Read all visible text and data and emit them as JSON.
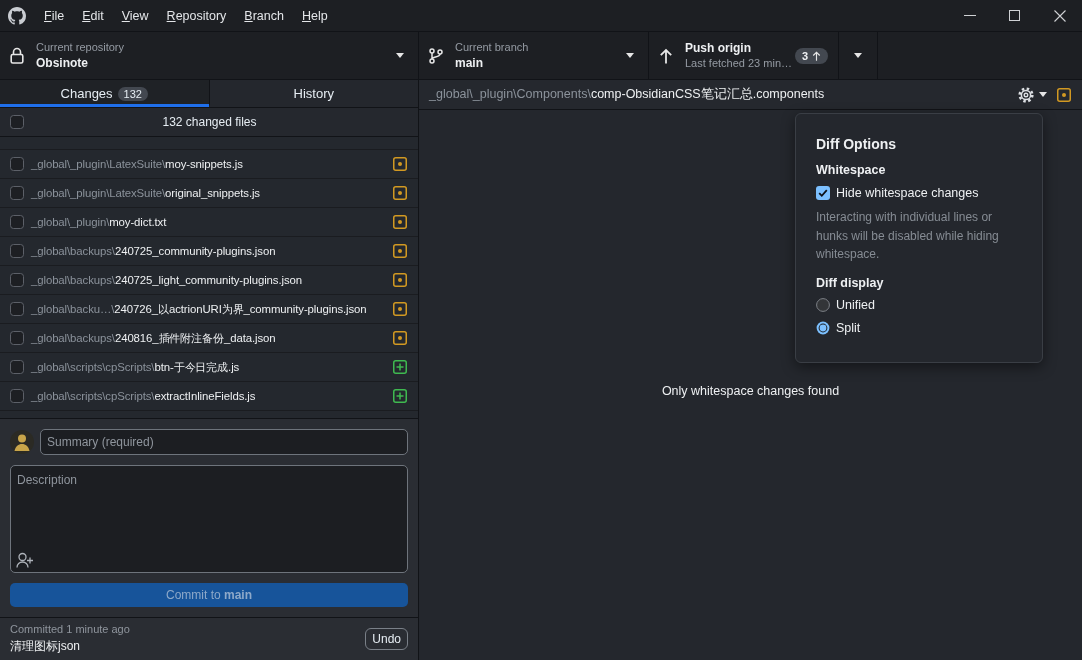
{
  "menu_bar": [
    "File",
    "Edit",
    "View",
    "Repository",
    "Branch",
    "Help"
  ],
  "toolbar": {
    "repository": {
      "label": "Current repository",
      "name": "Obsinote"
    },
    "branch": {
      "label": "Current branch",
      "name": "main"
    },
    "push": {
      "title": "Push origin",
      "subtitle": "Last fetched 23 min…",
      "ahead": "3"
    }
  },
  "tabs": [
    {
      "label": "Changes",
      "count": "132",
      "selected": true
    },
    {
      "label": "History",
      "selected": false
    }
  ],
  "changes": {
    "header": "132 changed files",
    "all_checked": false,
    "files": [
      {
        "directory": "_global\\_plugin\\LatexSuite\\",
        "filename": "moy-snippets.js",
        "kind": "modified",
        "checked": false
      },
      {
        "directory": "_global\\_plugin\\LatexSuite\\",
        "filename": "original_snippets.js",
        "kind": "modified",
        "checked": false
      },
      {
        "directory": "_global\\_plugin\\",
        "filename": "moy-dict.txt",
        "kind": "modified",
        "checked": false
      },
      {
        "directory": "_global\\backups\\",
        "filename": "240725_community-plugins.json",
        "kind": "modified",
        "checked": false
      },
      {
        "directory": "_global\\backups\\",
        "filename": "240725_light_community-plugins.json",
        "kind": "modified",
        "checked": false
      },
      {
        "directory": "_global\\backu…\\",
        "filename": "240726_以actrionURI为界_community-plugins.json",
        "kind": "modified",
        "checked": false
      },
      {
        "directory": "_global\\backups\\",
        "filename": "240816_插件附注备份_data.json",
        "kind": "modified",
        "checked": false
      },
      {
        "directory": "_global\\scripts\\cpScripts\\",
        "filename": "btn-于今日完成.js",
        "kind": "new",
        "checked": false
      },
      {
        "directory": "_global\\scripts\\cpScripts\\",
        "filename": "extractInlineFields.js",
        "kind": "new",
        "checked": false
      }
    ]
  },
  "commit": {
    "summary": {
      "placeholder": "Summary (required)"
    },
    "description": {
      "placeholder": "Description"
    },
    "button": {
      "label": "Commit to **main**",
      "disabled": true
    }
  },
  "last_commit": {
    "time": "Committed 1 minute ago",
    "message": "清理图标json",
    "undo": "Undo"
  },
  "diff": {
    "directory": "_global\\_plugin\\Components\\",
    "filename": "comp-ObsidianCSS笔记汇总.components",
    "kind": "modified",
    "message": "Only whitespace changes found"
  },
  "diff_options": {
    "title": "Diff Options",
    "whitespace": {
      "heading": "Whitespace",
      "checkbox": {
        "label": "Hide whitespace changes",
        "checked": true
      },
      "note": "Interacting with individual lines or hunks will be disabled while hiding whitespace."
    },
    "display": {
      "heading": "Diff display",
      "options": [
        {
          "label": "Unified",
          "selected": false
        },
        {
          "label": "Split",
          "selected": true
        }
      ]
    }
  }
}
